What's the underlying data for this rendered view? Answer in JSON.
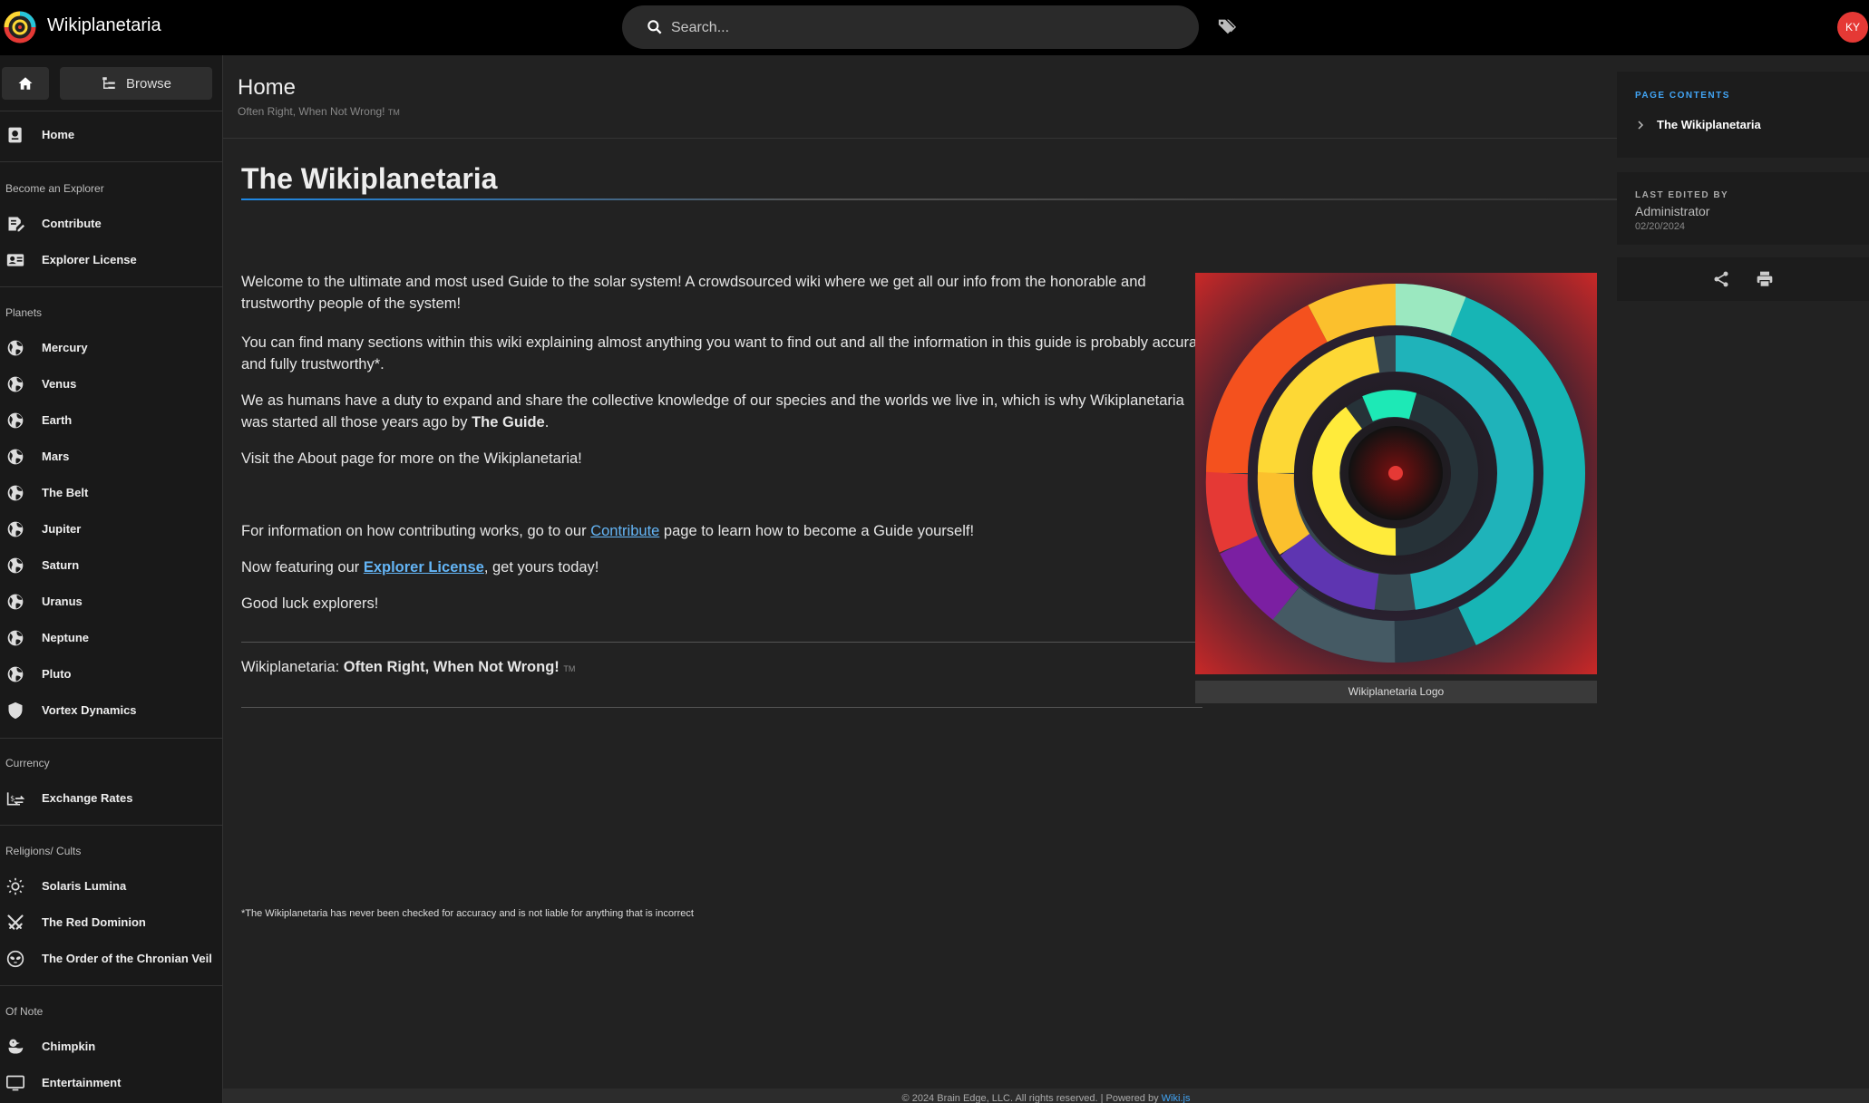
{
  "app": {
    "title": "Wikiplanetaria",
    "search_placeholder": "Search...",
    "avatar_initials": "KY"
  },
  "sidebar": {
    "home_label": "Home",
    "browse_label": "Browse",
    "top_items": [
      {
        "label": "Home",
        "icon": "home-page-icon"
      }
    ],
    "sections": [
      {
        "header": "Become an Explorer",
        "items": [
          {
            "label": "Contribute",
            "icon": "edit-note-icon"
          },
          {
            "label": "Explorer License",
            "icon": "id-card-icon"
          }
        ]
      },
      {
        "header": "Planets",
        "items": [
          {
            "label": "Mercury",
            "icon": "globe-icon"
          },
          {
            "label": "Venus",
            "icon": "globe-icon"
          },
          {
            "label": "Earth",
            "icon": "globe-icon"
          },
          {
            "label": "Mars",
            "icon": "globe-icon"
          },
          {
            "label": "The Belt",
            "icon": "globe-icon"
          },
          {
            "label": "Jupiter",
            "icon": "globe-icon"
          },
          {
            "label": "Saturn",
            "icon": "globe-icon"
          },
          {
            "label": "Uranus",
            "icon": "globe-icon"
          },
          {
            "label": "Neptune",
            "icon": "globe-icon"
          },
          {
            "label": "Pluto",
            "icon": "globe-icon"
          },
          {
            "label": "Vortex Dynamics",
            "icon": "shield-icon"
          }
        ]
      },
      {
        "header": "Currency",
        "items": [
          {
            "label": "Exchange Rates",
            "icon": "currency-exchange-icon"
          }
        ]
      },
      {
        "header": "Religions/ Cults",
        "items": [
          {
            "label": "Solaris Lumina",
            "icon": "sun-icon"
          },
          {
            "label": "The Red Dominion",
            "icon": "crossed-swords-icon"
          },
          {
            "label": "The Order of the Chronian Veil",
            "icon": "alien-icon"
          }
        ]
      },
      {
        "header": "Of Note",
        "items": [
          {
            "label": "Chimpkin",
            "icon": "duck-icon"
          },
          {
            "label": "Entertainment",
            "icon": "monitor-icon"
          }
        ]
      }
    ]
  },
  "page": {
    "title": "Home",
    "subtitle": "Often Right, When Not Wrong!",
    "tm": "TM",
    "heading": "The Wikiplanetaria",
    "p1": "Welcome to the ultimate and most used Guide to the solar system! A crowdsourced wiki where we get all our info from the honorable and trustworthy people of the system!",
    "p2": "You can find many sections within this wiki explaining almost anything you want to find out and all the information in this guide is probably accurate* and fully trustworthy*.",
    "p3_a": "We as humans have a duty to expand and share the collective knowledge of our species and the worlds we live in, which is why Wikiplanetaria was started all those years ago by ",
    "p3_b": "The Guide",
    "p3_c": ".",
    "p4": "Visit the About page for more on the Wikiplanetaria!",
    "p5_a": "For information on how contributing works, go to our ",
    "p5_link": "Contribute",
    "p5_b": " page to learn how to become a Guide yourself!",
    "p6_a": "Now featuring our ",
    "p6_link": "Explorer License",
    "p6_b": ", get yours today!",
    "p7": "Good luck explorers!",
    "motto_a": "Wikiplanetaria: ",
    "motto_b": "Often Right, When Not Wrong!",
    "footnote": "*The Wikiplanetaria has never been checked for accuracy and is not liable for anything that is incorrect",
    "image_caption": "Wikiplanetaria Logo"
  },
  "right_panel": {
    "contents_label": "PAGE CONTENTS",
    "contents_item": "The Wikiplanetaria",
    "last_edited_label": "LAST EDITED BY",
    "last_edited_by": "Administrator",
    "last_edited_date": "02/20/2024"
  },
  "footer": {
    "text": "© 2024 Brain Edge, LLC. All rights reserved. | Powered by ",
    "link": "Wiki.js"
  }
}
